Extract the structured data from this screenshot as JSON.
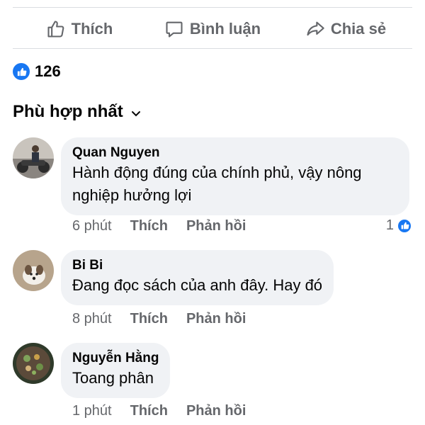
{
  "actions": {
    "like_label": "Thích",
    "comment_label": "Bình luận",
    "share_label": "Chia sẻ"
  },
  "reactions": {
    "count": "126",
    "icon": "like-icon",
    "color": "#1877f2"
  },
  "sort": {
    "label": "Phù hợp nhất",
    "icon": "chevron-down-icon"
  },
  "comments": [
    {
      "author": "Quan Nguyen",
      "text": "Hành động đúng của chính phủ, vậy nông nghiệp hưởng lợi",
      "time": "6 phút",
      "like_label": "Thích",
      "reply_label": "Phản hồi",
      "reaction_count": "1"
    },
    {
      "author": "Bi Bi",
      "text": "Đang đọc sách của anh đây. Hay đó",
      "time": "8 phút",
      "like_label": "Thích",
      "reply_label": "Phản hồi"
    },
    {
      "author": "Nguyễn Hằng",
      "text": "Toang phân",
      "time": "1 phút",
      "like_label": "Thích",
      "reply_label": "Phản hồi"
    }
  ]
}
